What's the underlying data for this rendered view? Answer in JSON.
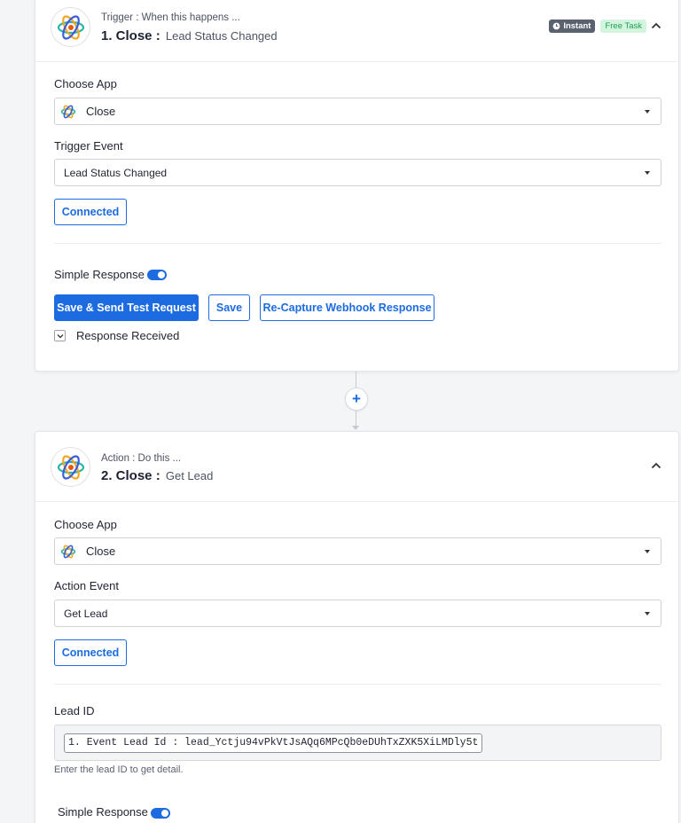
{
  "step1": {
    "kicker": "Trigger : When this happens ...",
    "title": "1. Close :",
    "subtitle": "Lead Status Changed",
    "badge_instant": "Instant",
    "badge_free": "Free Task",
    "choose_app_label": "Choose App",
    "app_value": "Close",
    "event_label": "Trigger Event",
    "event_value": "Lead Status Changed",
    "connected_label": "Connected",
    "simple_response_label": "Simple Response",
    "simple_response_on": true,
    "save_send_label": "Save & Send Test Request",
    "save_label": "Save",
    "recapture_label": "Re-Capture Webhook Response",
    "response_received_label": "Response Received"
  },
  "step2": {
    "kicker": "Action : Do this ...",
    "title": "2. Close :",
    "subtitle": "Get Lead",
    "choose_app_label": "Choose App",
    "app_value": "Close",
    "event_label": "Action Event",
    "event_value": "Get Lead",
    "connected_label": "Connected",
    "lead_id_label": "Lead ID",
    "lead_id_token": "1. Event Lead Id : lead_Yctju94vPkVtJsAQq6MPcQb0eDUhTxZXK5XiLMDly5t",
    "lead_id_hint": "Enter the lead ID to get detail.",
    "simple_response_label": "Simple Response",
    "simple_response_on": true
  },
  "colors": {
    "accent": "#1c6be0",
    "free_badge_bg": "#d3f5e0",
    "instant_badge_bg": "#5a6270"
  },
  "icons": [
    "close-app-logo",
    "chevron-up-icon",
    "caret-down-icon",
    "clock-icon",
    "plus-icon",
    "check-icon"
  ]
}
